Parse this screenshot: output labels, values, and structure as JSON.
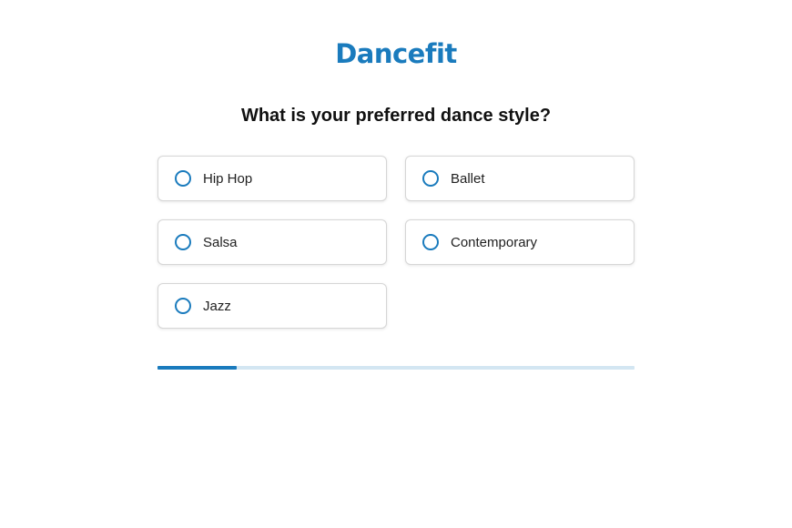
{
  "brand": {
    "name": "Dancefit",
    "color": "#1a7bbd"
  },
  "question": "What is your preferred dance style?",
  "options": [
    {
      "label": "Hip Hop",
      "selected": false
    },
    {
      "label": "Ballet",
      "selected": false
    },
    {
      "label": "Salsa",
      "selected": false
    },
    {
      "label": "Contemporary",
      "selected": false
    },
    {
      "label": "Jazz",
      "selected": false
    }
  ],
  "progress": {
    "fraction": 0.166,
    "fill_color": "#1a7bbd",
    "track_color": "#d3e6f2"
  }
}
